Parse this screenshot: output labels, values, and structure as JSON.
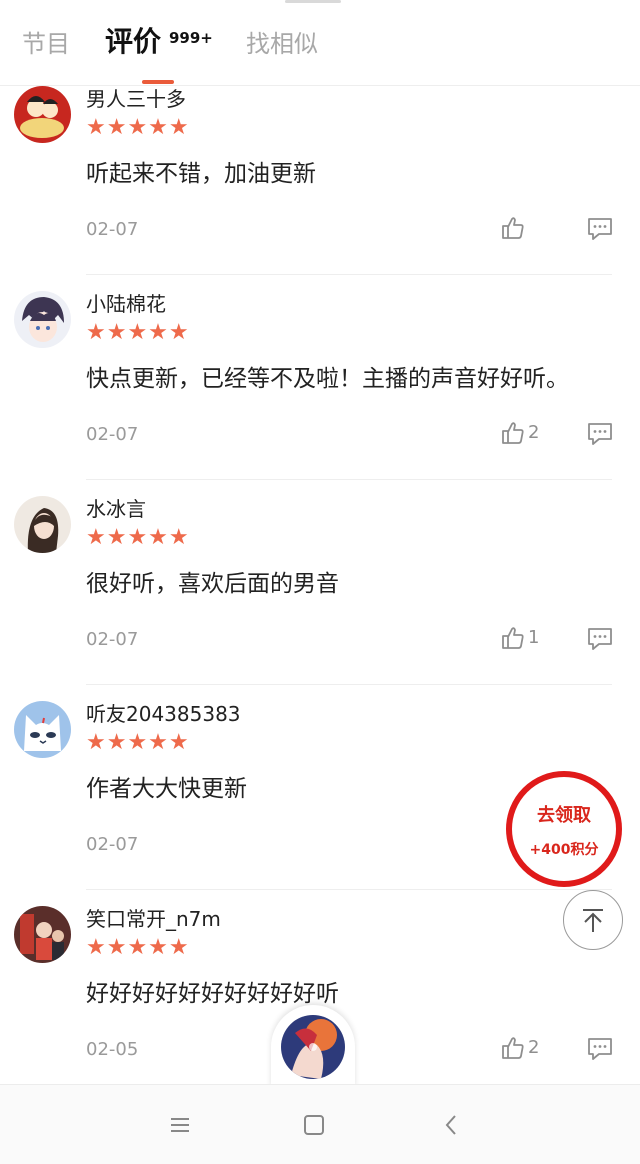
{
  "tabs": {
    "programs": "节目",
    "reviews": "评价",
    "reviews_count": "999+",
    "similar": "找相似"
  },
  "rating_stars": "★★★★★",
  "reviews": [
    {
      "user": "男人三十多",
      "content": "听起来不错，加油更新",
      "date": "02-07",
      "likes": ""
    },
    {
      "user": "小陆棉花",
      "content": "快点更新，已经等不及啦！主播的声音好好听。",
      "date": "02-07",
      "likes": "2"
    },
    {
      "user": "水冰言",
      "content": "很好听，喜欢后面的男音",
      "date": "02-07",
      "likes": "1"
    },
    {
      "user": "听友204385383",
      "content": "作者大大快更新",
      "date": "02-07",
      "likes": ""
    },
    {
      "user": "笑口常开_n7m",
      "content": "好好好好好好好好好好听",
      "date": "02-05",
      "likes": "2"
    }
  ],
  "reward": {
    "line1": "去领取",
    "line2": "+400积分"
  },
  "colors": {
    "accent": "#ea5b3a",
    "star": "#ee6a4b",
    "reward": "#e01a1a"
  },
  "icons": [
    "thumbs-up-icon",
    "comment-icon",
    "back-to-top-icon",
    "menu-icon",
    "home-icon",
    "back-icon"
  ]
}
